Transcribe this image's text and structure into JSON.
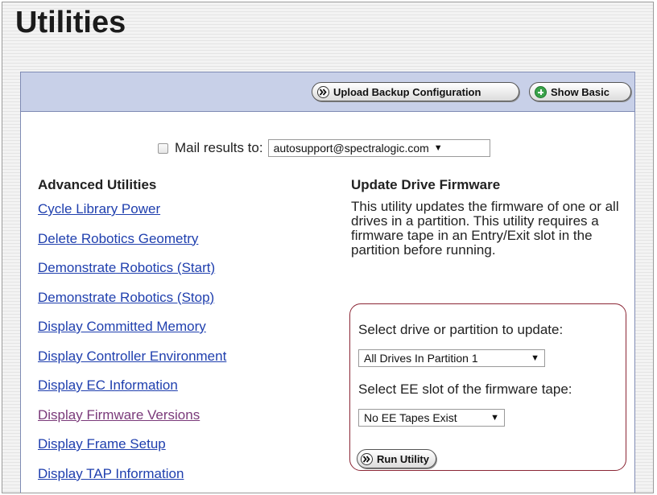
{
  "page": {
    "title": "Utilities"
  },
  "toolbar": {
    "upload_label": "Upload Backup Configuration",
    "show_basic_label": "Show Basic"
  },
  "mail": {
    "checked": false,
    "label": "Mail results to:",
    "selected": "autosupport@spectralogic.com"
  },
  "advanced": {
    "heading": "Advanced Utilities",
    "links": [
      {
        "label": "Cycle Library Power",
        "visited": false
      },
      {
        "label": "Delete Robotics Geometry",
        "visited": false
      },
      {
        "label": "Demonstrate Robotics (Start)",
        "visited": false
      },
      {
        "label": "Demonstrate Robotics (Stop)",
        "visited": false
      },
      {
        "label": "Display Committed Memory",
        "visited": false
      },
      {
        "label": "Display Controller Environment",
        "visited": false
      },
      {
        "label": "Display EC Information",
        "visited": false
      },
      {
        "label": "Display Firmware Versions",
        "visited": true
      },
      {
        "label": "Display Frame Setup",
        "visited": false
      },
      {
        "label": "Display TAP Information",
        "visited": false
      }
    ]
  },
  "utility": {
    "heading": "Update Drive Firmware",
    "description": "This utility updates the firmware of one or all drives in a partition. This utility requires a firmware tape in an Entry/Exit slot in the partition before running.",
    "drive_label": "Select drive or partition to update:",
    "drive_selected": "All Drives In Partition 1",
    "ee_label": "Select EE slot of the firmware tape:",
    "ee_selected": "No EE Tapes Exist",
    "run_label": "Run Utility"
  },
  "colors": {
    "toolbar_bg": "#c8d0e8",
    "link": "#1f3fae",
    "link_visited": "#7a3a7a",
    "highlight_border": "#8b2635",
    "plus_icon": "#3aa24a"
  },
  "icons": {
    "upload": "double-chevron-right-icon",
    "show_basic": "plus-circle-icon",
    "run": "double-chevron-right-icon",
    "dropdown": "caret-down-icon"
  }
}
